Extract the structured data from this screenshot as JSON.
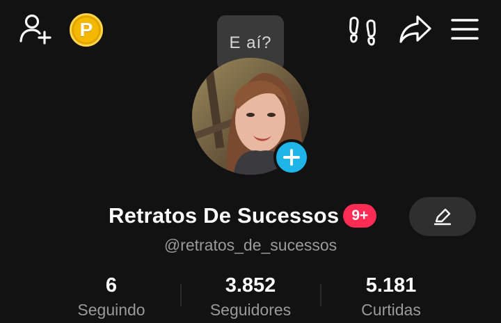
{
  "topbar": {
    "icons": [
      "add-friend-icon",
      "coin-icon",
      "footprint-icon",
      "share-icon",
      "menu-icon"
    ],
    "coin_letter": "P"
  },
  "tooltip": {
    "text": "E aí?"
  },
  "profile": {
    "display_name": "Retratos De Sucessos",
    "badge": "9+",
    "username": "@retratos_de_sucessos"
  },
  "stats": [
    {
      "value": "6",
      "label": "Seguindo"
    },
    {
      "value": "3.852",
      "label": "Seguidores"
    },
    {
      "value": "5.181",
      "label": "Curtidas"
    }
  ],
  "colors": {
    "background": "#121212",
    "badge": "#fe2c55",
    "add_avatar": "#20b5e8",
    "coin": "#f5b800"
  }
}
